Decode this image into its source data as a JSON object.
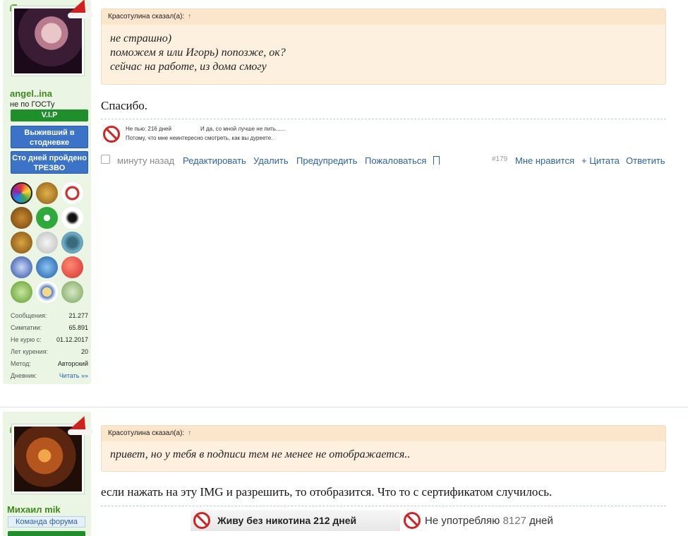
{
  "post1": {
    "user": {
      "name": "angel..ina",
      "title": "не по ГОСТу",
      "badge_vip": "V.I.P",
      "badge_survivor": "Выживший в стодневке",
      "badge_hundred": "Сто дней пройдено ТРЕЗВО",
      "trophies": [
        "trophy-rainbow",
        "trophy-sphinx",
        "trophy-dragon",
        "trophy-stars",
        "trophy-first-aid",
        "trophy-fairy",
        "trophy-cup",
        "trophy-chef",
        "trophy-wheel",
        "trophy-snowflake",
        "trophy-people",
        "trophy-tomato",
        "trophy-plant",
        "trophy-medal",
        "trophy-bird"
      ],
      "stats": [
        {
          "label": "Сообщения:",
          "value": "21.277"
        },
        {
          "label": "Симпатии:",
          "value": "65.891"
        },
        {
          "label": "Не курю с:",
          "value": "01.12.2017"
        },
        {
          "label": "Лет курения:",
          "value": "20"
        },
        {
          "label": "Метод:",
          "value": "Авторский"
        },
        {
          "label": "Дневник:",
          "value": "Читать »»"
        }
      ]
    },
    "quote": {
      "author": "Красотулина сказал(а):",
      "arrow": "↑",
      "lines": [
        "не страшно)",
        "поможем я или Игорь) попозже, ок?",
        "сейчас на работе, из дома смогу"
      ]
    },
    "message": "Спасибо.",
    "signature": {
      "days": "Не пью: 216 дней",
      "quote": "И да, со мной лучше не пить......",
      "line2": "Потому, что мне неинтересно смотреть, как вы дуреете."
    },
    "actions": {
      "time": "минуту назад",
      "edit": "Редактировать",
      "delete": "Удалить",
      "warn": "Предупредить",
      "report": "Пожаловаться",
      "post_number": "#179",
      "like": "Мне нравится",
      "quote": "+ Цитата",
      "reply": "Ответить"
    }
  },
  "post2": {
    "user": {
      "name": "Михаил mik",
      "badge_team": "Команда форума"
    },
    "quote": {
      "author": "Красотулина сказал(а):",
      "arrow": "↑",
      "lines": [
        "привет, но у тебя в подписи тем не менее не отображается.."
      ]
    },
    "message": "если нажать на эту IMG и разрешить, то отобразится. Что то с сертификатом случилось.",
    "signature": {
      "nicotine": "Живу без никотина 212 дней",
      "drink_prefix": "Не употребляю",
      "drink_num": "8127",
      "drink_suffix": "дней"
    }
  }
}
